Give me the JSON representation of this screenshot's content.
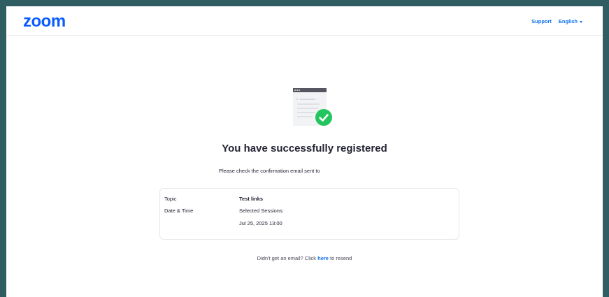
{
  "header": {
    "logo": "zoom",
    "support_label": "Support",
    "language_label": "English"
  },
  "illustration": {
    "icon": "registration-confirmed-document-with-check",
    "check_color": "#22c55e"
  },
  "main": {
    "title": "You have successfully registered",
    "subtitle": "Please check the confirmation email sent to"
  },
  "details": {
    "topic_label": "Topic",
    "topic_value": "Test links",
    "datetime_label": "Date & Time",
    "sessions_label": "Selected Sessions:",
    "session_value": "Jul 25, 2025 13:00"
  },
  "resend": {
    "prefix": "Didn't get an email? Click ",
    "link": "here",
    "suffix": " to resend"
  },
  "colors": {
    "brand": "#0b5cff",
    "link": "#0e72ed",
    "frame": "#2f5d62",
    "text": "#232333"
  }
}
